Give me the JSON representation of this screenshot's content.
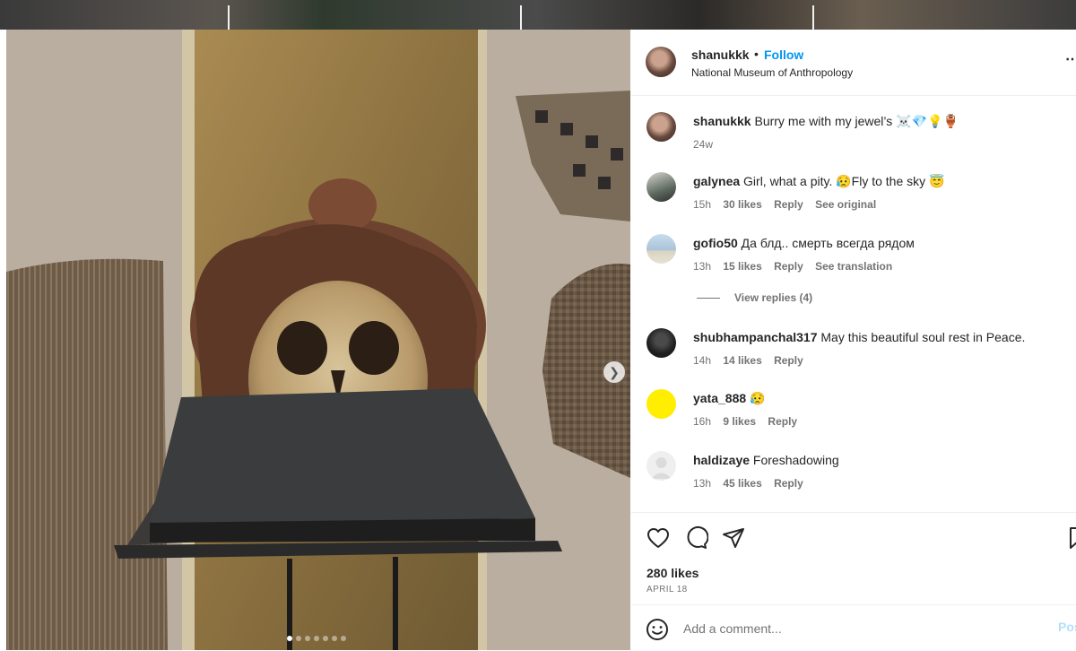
{
  "post": {
    "username": "shanukkk",
    "separator": "•",
    "follow_label": "Follow",
    "location": "National Museum of Anthropology",
    "more_label": "⋯"
  },
  "comments": [
    {
      "username": "shanukkk",
      "text": "Burry me with my jewel’s ☠️💎💡🏺",
      "time": "24w",
      "likes": "",
      "reply": "",
      "extra": "",
      "avatar_color": "#8a6a5c"
    },
    {
      "username": "galynea",
      "text": "Girl, what a pity. 😥Fly to the sky 😇",
      "time": "15h",
      "likes": "30 likes",
      "reply": "Reply",
      "extra": "See original",
      "avatar_color": "#5d6a5f"
    },
    {
      "username": "gofio50",
      "text": "Да блд.. смерть всегда рядом",
      "time": "13h",
      "likes": "15 likes",
      "reply": "Reply",
      "extra": "See translation",
      "avatar_color": "#a9c3d8"
    },
    {
      "username": "shubhampanchal317",
      "text": "May this beautiful soul rest in Peace.",
      "time": "14h",
      "likes": "14 likes",
      "reply": "Reply",
      "extra": "",
      "avatar_color": "#1e1e1e"
    },
    {
      "username": "yata_888",
      "text": "😥",
      "time": "16h",
      "likes": "9 likes",
      "reply": "Reply",
      "extra": "",
      "avatar_color": "#ffee00"
    },
    {
      "username": "haldizaye",
      "text": "Foreshadowing",
      "time": "13h",
      "likes": "45 likes",
      "reply": "Reply",
      "extra": "",
      "avatar_color": "#dbdbdb"
    }
  ],
  "view_replies": "View replies (4)",
  "actions": {
    "icons": [
      "heart-icon",
      "comment-icon",
      "share-icon",
      "bookmark-icon"
    ],
    "likes": "280 likes",
    "date": "APRIL 18"
  },
  "composer": {
    "placeholder": "Add a comment...",
    "post_label": "Post"
  },
  "carousel": {
    "total": 7,
    "active_index": 0
  }
}
